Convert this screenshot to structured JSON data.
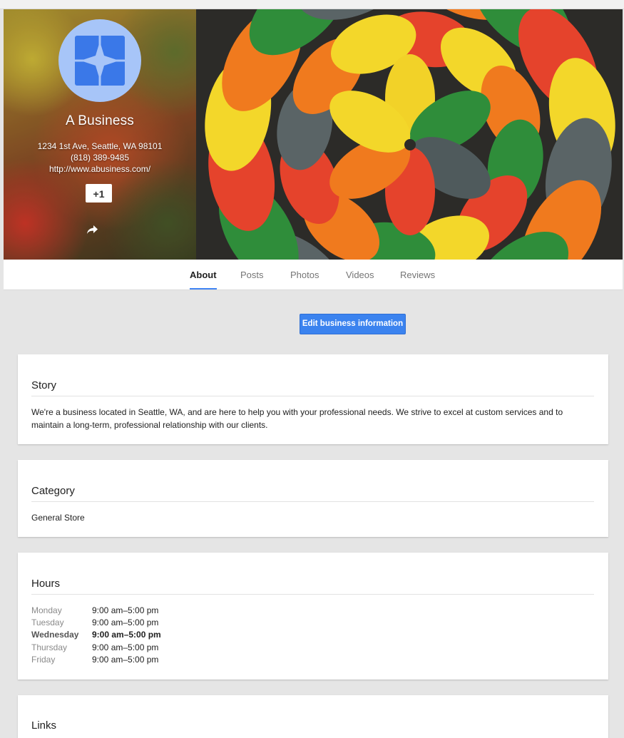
{
  "business": {
    "name": "A Business",
    "address": "1234 1st Ave, Seattle, WA 98101",
    "phone": "(818) 389-9485",
    "website": "http://www.abusiness.com/",
    "plus_one_label": "+1"
  },
  "tabs": [
    {
      "label": "About",
      "active": true
    },
    {
      "label": "Posts",
      "active": false
    },
    {
      "label": "Photos",
      "active": false
    },
    {
      "label": "Videos",
      "active": false
    },
    {
      "label": "Reviews",
      "active": false
    }
  ],
  "edit_button_label": "Edit business information",
  "story": {
    "title": "Story",
    "text": "We're a business located in Seattle, WA, and are here to help you with your professional needs. We strive to excel at custom services and to maintain a long-term, professional relationship with our clients."
  },
  "category": {
    "title": "Category",
    "value": "General Store"
  },
  "hours": {
    "title": "Hours",
    "rows": [
      {
        "day": "Monday",
        "time": "9:00 am–5:00 pm"
      },
      {
        "day": "Tuesday",
        "time": "9:00 am–5:00 pm"
      },
      {
        "day": "Wednesday",
        "time": "9:00 am–5:00 pm"
      },
      {
        "day": "Thursday",
        "time": "9:00 am–5:00 pm"
      },
      {
        "day": "Friday",
        "time": "9:00 am–5:00 pm"
      }
    ],
    "highlighted_day": "Wednesday"
  },
  "links": {
    "title": "Links"
  },
  "colors": {
    "accent": "#4285f4",
    "button": "#3b83ef",
    "avatar_bg": "#a7c5f8",
    "logo_blue": "#3a78e8"
  },
  "icons": [
    "business-logo-icon",
    "share-icon"
  ]
}
